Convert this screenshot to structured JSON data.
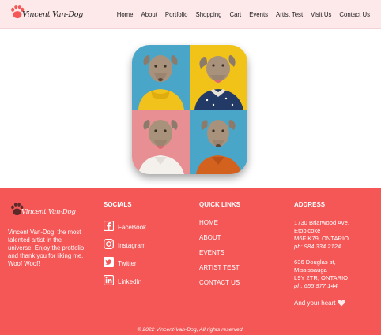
{
  "header": {
    "logo_text": "Vincent Van-Dog",
    "nav": [
      "Home",
      "About",
      "Portfolio",
      "Shopping",
      "Cart",
      "Events",
      "Artist Test",
      "Visit Us",
      "Contact Us"
    ]
  },
  "footer": {
    "logo_text": "Vincent Van-Dog",
    "about": "Vincent Van-Dog, the most talented artist in the universe! Enjoy the protfolio and thank you for liking me. Woof Woof!",
    "socials_title": "SOCIALS",
    "socials": [
      {
        "label": "FaceBook",
        "icon": "facebook-icon"
      },
      {
        "label": "Instagram",
        "icon": "instagram-icon"
      },
      {
        "label": "Twitter",
        "icon": "twitter-icon"
      },
      {
        "label": "LinkedIn",
        "icon": "linkedin-icon"
      }
    ],
    "quick_links_title": "QUICK LINKS",
    "quick_links": [
      "HOME",
      "ABOUT",
      "EVENTS",
      "ARTIST TEST",
      "CONTACT US"
    ],
    "address_title": "ADDRESS",
    "address1": {
      "line1": "1730 Briarwood Ave,",
      "line2": "Etobicoke",
      "line3": "M6F K79, ONTARIO",
      "phone": "ph: 984 334 2124"
    },
    "address2": {
      "line1": "636 Douglas st,",
      "line2": "Mississauga",
      "line3": "L9Y 2TR, ONTARIO",
      "phone": "ph: 655 977 144"
    },
    "heart_text": "And your heart",
    "copyright": "© 2022 Vincent-Van-Dog, All rights reserved."
  },
  "colors": {
    "header_bg": "#fde8ea",
    "footer_bg": "#f55656",
    "paw": "#f55656"
  }
}
